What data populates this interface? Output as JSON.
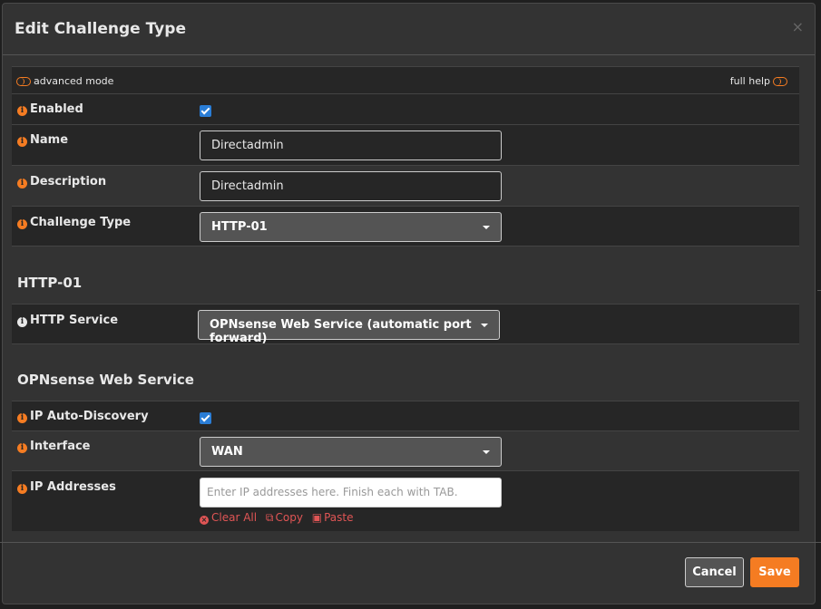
{
  "modal": {
    "title": "Edit Challenge Type",
    "close_label": "×"
  },
  "toolbar": {
    "advanced_mode_label": "advanced mode",
    "full_help_label": "full help"
  },
  "fields": {
    "enabled": {
      "label": "Enabled",
      "checked": true
    },
    "name": {
      "label": "Name",
      "value": "Directadmin"
    },
    "description": {
      "label": "Description",
      "value": "Directadmin"
    },
    "challenge_type": {
      "label": "Challenge Type",
      "selected": "HTTP-01"
    }
  },
  "sections": {
    "http01": "HTTP-01",
    "opnsense_web": "OPNsense Web Service"
  },
  "http": {
    "service": {
      "label": "HTTP Service",
      "selected": "OPNsense Web Service (automatic port forward)"
    }
  },
  "web": {
    "ip_auto_discovery": {
      "label": "IP Auto-Discovery",
      "checked": true
    },
    "interface": {
      "label": "Interface",
      "selected": "WAN"
    },
    "ip_addresses": {
      "label": "IP Addresses",
      "placeholder": "Enter IP addresses here. Finish each with TAB.",
      "clear_all": "Clear All",
      "copy": "Copy",
      "paste": "Paste"
    }
  },
  "buttons": {
    "cancel": "Cancel",
    "save": "Save"
  },
  "colors": {
    "accent": "#f57c22",
    "checkbox": "#2a7dd6",
    "danger": "#e05555"
  }
}
